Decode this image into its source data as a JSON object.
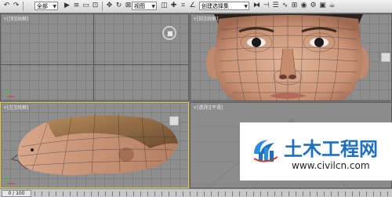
{
  "toolbar": {
    "selection_filter": "全部",
    "coord_system": "视图",
    "named_selection": "创建选择集"
  },
  "viewports": {
    "top": "+[顶][线框]",
    "front": "+[前][线框]",
    "left": "+[左][线框]",
    "perspective": "+[透视][平滑]"
  },
  "timeline": {
    "frame": "0 / 100"
  },
  "watermark": {
    "title": "土木工程网",
    "url": "www.civilcn.com"
  },
  "colors": {
    "active_viewport_border": "#e3c84a",
    "watermark_blue": "#1e6fbf"
  }
}
